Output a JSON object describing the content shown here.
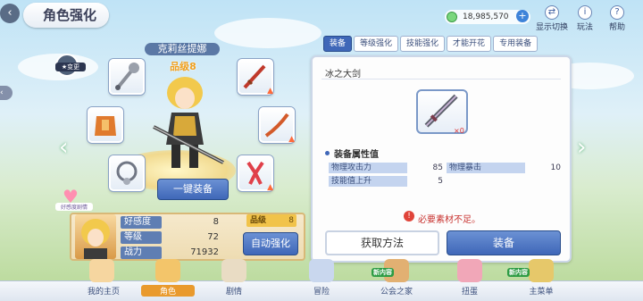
{
  "header": {
    "title": "角色强化",
    "back_icon": "back-icon",
    "currency_value": "18,985,570"
  },
  "top_buttons": [
    {
      "label": "显示切换",
      "icon": "display-toggle-icon"
    },
    {
      "label": "玩法",
      "icon": "info-icon"
    },
    {
      "label": "帮助",
      "icon": "help-icon"
    }
  ],
  "character": {
    "name": "克莉丝提娜",
    "grade": "品级8",
    "expand_label": "★变更"
  },
  "one_click_equip": "一键装备",
  "affection_badge": "好感度剧情",
  "stats": {
    "rows": [
      {
        "label": "好感度",
        "value": "8"
      },
      {
        "label": "等级",
        "value": "72"
      },
      {
        "label": "战力",
        "value": "71932"
      }
    ],
    "grade_label": "品级",
    "grade_value": "8",
    "auto_enhance": "自动强化"
  },
  "tabs": [
    {
      "label": "装备",
      "active": true
    },
    {
      "label": "等级强化",
      "active": false
    },
    {
      "label": "技能强化",
      "active": false
    },
    {
      "label": "才能开花",
      "active": false
    },
    {
      "label": "专用装备",
      "active": false
    }
  ],
  "item": {
    "name": "冰之大剑",
    "count": "×0",
    "attr_header": "装备属性值",
    "attrs": [
      {
        "label": "物理攻击力",
        "value": "85"
      },
      {
        "label": "物理暴击",
        "value": "10"
      },
      {
        "label": "技能值上升",
        "value": "5"
      }
    ],
    "warning": "必要素材不足。",
    "get_method": "获取方法",
    "equip": "装备"
  },
  "nav": [
    {
      "label": "我的主页"
    },
    {
      "label": "角色"
    },
    {
      "label": "剧情"
    },
    {
      "label": "冒险"
    },
    {
      "label": "公会之家",
      "badge": "新内容"
    },
    {
      "label": "扭蛋"
    },
    {
      "label": "主菜单",
      "badge": "新内容"
    }
  ],
  "colors": {
    "accent": "#3f67b8",
    "warning": "#c8322f",
    "panel_border": "#ccd7e8",
    "stat_card": "#f1e3c2"
  }
}
